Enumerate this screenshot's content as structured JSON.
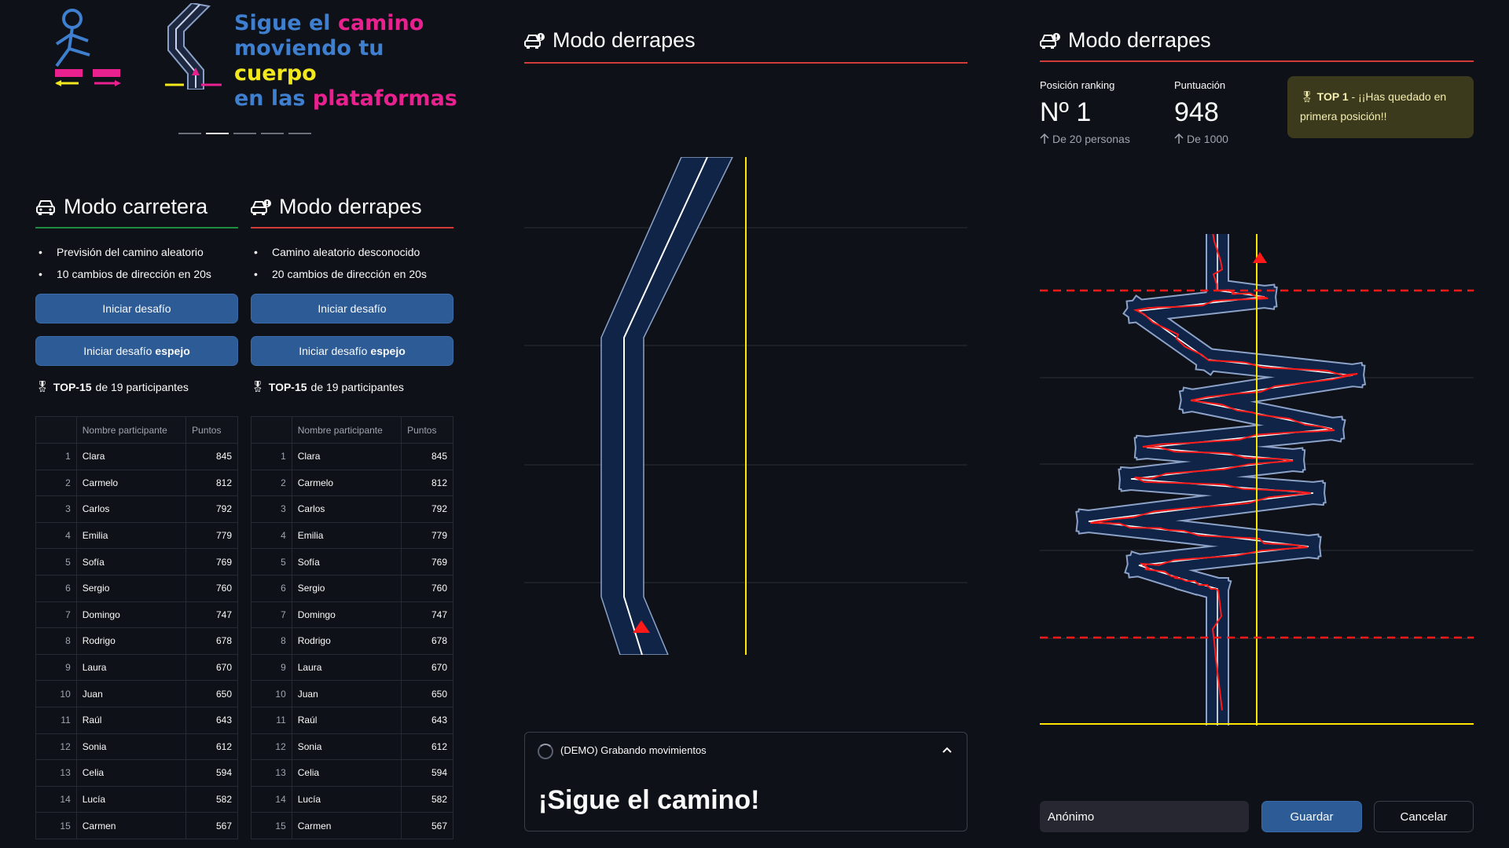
{
  "banner": {
    "line1_a": "Sigue el ",
    "line1_b": "camino",
    "line2_a": "moviendo tu ",
    "line2_b": "cuerpo",
    "line3_a": "en las ",
    "line3_b": "plataformas",
    "carousel_active_index": 1,
    "carousel_count": 5
  },
  "modes": [
    {
      "title": "Modo carretera",
      "icon": "car-icon",
      "accent": "#1f8b3f",
      "bullets": [
        "Previsión del camino aleatorio",
        "10 cambios de dirección en 20s"
      ],
      "button_start": "Iniciar desafío",
      "button_mirror_a": "Iniciar desafío",
      "button_mirror_b": "espejo",
      "top_label_a": "TOP-15",
      "top_label_b": " de 19 participantes"
    },
    {
      "title": "Modo derrapes",
      "icon": "drift-car-icon",
      "accent": "#d33a3a",
      "bullets": [
        "Camino aleatorio desconocido",
        "20 cambios de dirección en 20s"
      ],
      "button_start": "Iniciar desafío",
      "button_mirror_a": "Iniciar desafío",
      "button_mirror_b": "espejo",
      "top_label_a": "TOP-15",
      "top_label_b": " de 19 participantes"
    }
  ],
  "table": {
    "col_name": "Nombre participante",
    "col_points": "Puntos",
    "rows": [
      {
        "i": "1",
        "name": "Clara",
        "pts": "845"
      },
      {
        "i": "2",
        "name": "Carmelo",
        "pts": "812"
      },
      {
        "i": "3",
        "name": "Carlos",
        "pts": "792"
      },
      {
        "i": "4",
        "name": "Emilia",
        "pts": "779"
      },
      {
        "i": "5",
        "name": "Sofía",
        "pts": "769"
      },
      {
        "i": "6",
        "name": "Sergio",
        "pts": "760"
      },
      {
        "i": "7",
        "name": "Domingo",
        "pts": "747"
      },
      {
        "i": "8",
        "name": "Rodrigo",
        "pts": "678"
      },
      {
        "i": "9",
        "name": "Laura",
        "pts": "670"
      },
      {
        "i": "10",
        "name": "Juan",
        "pts": "650"
      },
      {
        "i": "11",
        "name": "Raúl",
        "pts": "643"
      },
      {
        "i": "12",
        "name": "Sonia",
        "pts": "612"
      },
      {
        "i": "13",
        "name": "Celia",
        "pts": "594"
      },
      {
        "i": "14",
        "name": "Lucía",
        "pts": "582"
      },
      {
        "i": "15",
        "name": "Carmen",
        "pts": "567"
      }
    ]
  },
  "center": {
    "title": "Modo derrapes",
    "expander_label": "(DEMO) Grabando movimientos",
    "big_text": "¡Sigue el camino!"
  },
  "right": {
    "title": "Modo derrapes",
    "metric1_label": "Posición ranking",
    "metric1_value": "Nº 1",
    "metric1_delta": "De 20 personas",
    "metric2_label": "Puntuación",
    "metric2_value": "948",
    "metric2_delta": "De 1000",
    "alert_a": "TOP 1",
    "alert_b": " - ¡¡Has quedado en primera posición!!",
    "name_value": "Anónimo",
    "save_label": "Guardar",
    "cancel_label": "Cancelar"
  },
  "colors": {
    "background": "#0e1117",
    "button": "#2d5b95",
    "road": "#0f2446",
    "accent_yellow": "#ffe600",
    "accent_red": "#ff1a1a"
  }
}
